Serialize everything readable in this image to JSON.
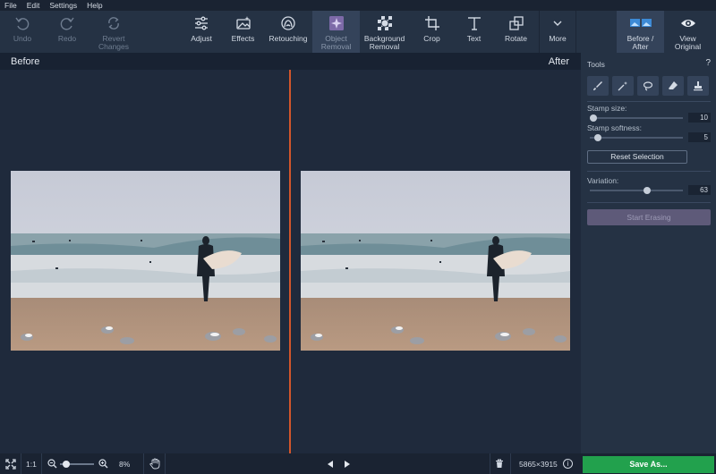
{
  "menu": [
    "File",
    "Edit",
    "Settings",
    "Help"
  ],
  "toolbar": {
    "undo": "Undo",
    "redo": "Redo",
    "revert": [
      "Revert",
      "Changes"
    ],
    "adjust": "Adjust",
    "effects": "Effects",
    "retouching": "Retouching",
    "object_removal": [
      "Object",
      "Removal"
    ],
    "background_removal": [
      "Background",
      "Removal"
    ],
    "crop": "Crop",
    "text": "Text",
    "rotate": "Rotate",
    "more": "More",
    "before_after": [
      "Before /",
      "After"
    ],
    "view_original": [
      "View",
      "Original"
    ]
  },
  "compare": {
    "before": "Before",
    "after": "After"
  },
  "panel": {
    "tools_label": "Tools",
    "help": "?",
    "stamp_size": {
      "label": "Stamp size:",
      "value": "10",
      "fraction": 0.0
    },
    "stamp_softness": {
      "label": "Stamp softness:",
      "value": "5",
      "fraction": 0.05
    },
    "reset_selection": "Reset Selection",
    "variation": {
      "label": "Variation:",
      "value": "63",
      "fraction": 0.63
    },
    "start_erasing": "Start Erasing"
  },
  "status": {
    "ratio": "1:1",
    "zoom": "8%",
    "zoom_fraction": 0.1,
    "dimensions": "5865×3915",
    "info": "i",
    "save": "Save As..."
  },
  "colors": {
    "accent_divider": "#d2562b",
    "save_green": "#22a14d",
    "erase_button": "#5e5a79"
  },
  "icons": [
    "undo-icon",
    "redo-icon",
    "revert-icon",
    "adjust-icon",
    "effects-icon",
    "retouching-icon",
    "object-removal-icon",
    "background-removal-icon",
    "crop-icon",
    "text-icon",
    "rotate-icon",
    "more-icon",
    "before-after-icon",
    "eye-icon",
    "brush-icon",
    "magic-wand-icon",
    "lasso-icon",
    "eraser-icon",
    "stamp-icon",
    "fit-screen-icon",
    "zoom-out-icon",
    "zoom-in-icon",
    "hand-icon",
    "prev-icon",
    "next-icon",
    "trash-icon",
    "info-icon"
  ]
}
